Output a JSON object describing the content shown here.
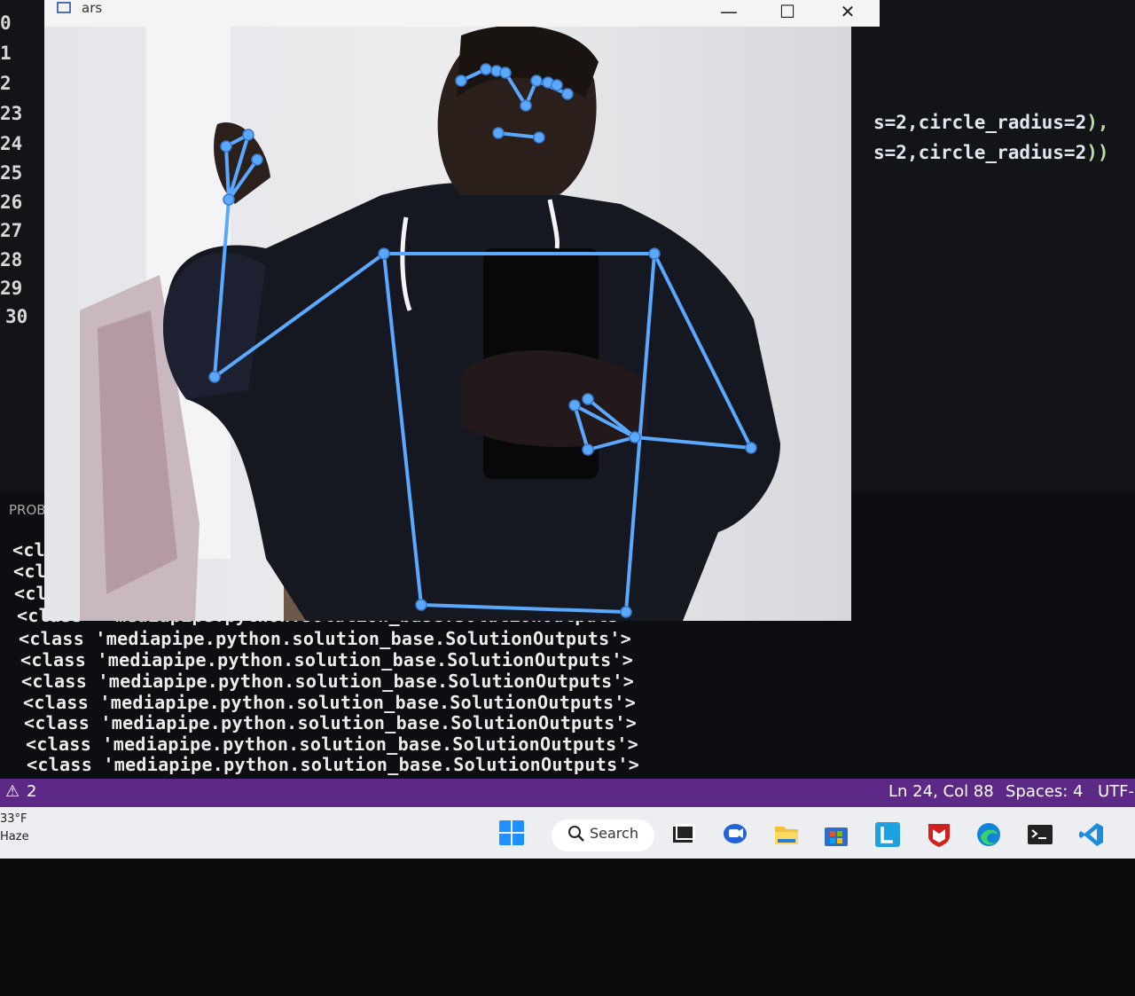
{
  "editor": {
    "line_numbers": [
      "0",
      "1",
      "2",
      "23",
      "24",
      "25",
      "26",
      "27",
      "28",
      "29",
      "30"
    ],
    "code_line_1_prefix": "s=2,circle_radius=2",
    "code_line_1_suffix": "),",
    "code_line_2_prefix": "s=2,circle_radius=2",
    "code_line_2_suffix": "))"
  },
  "panel": {
    "title": "PROBLEM",
    "output_lines": [
      "<class",
      "<class",
      "<class",
      "<class  'mediapipe.python.solution_base.SolutionOutputs'>",
      "<class 'mediapipe.python.solution_base.SolutionOutputs'>",
      "<class 'mediapipe.python.solution_base.SolutionOutputs'>",
      "<class 'mediapipe.python.solution_base.SolutionOutputs'>",
      "<class 'mediapipe.python.solution_base.SolutionOutputs'>",
      "<class 'mediapipe.python.solution_base.SolutionOutputs'>",
      "<class 'mediapipe.python.solution_base.SolutionOutputs'>",
      "<class 'mediapipe.python.solution_base.SolutionOutputs'>"
    ]
  },
  "statusbar": {
    "warnings": "2",
    "cursor": "Ln 24, Col 88",
    "spaces": "Spaces: 4",
    "encoding": "UTF-"
  },
  "taskbar": {
    "temperature": "33°F",
    "weather": "Haze",
    "search_label": "Search",
    "icons": [
      "windows-start-icon",
      "search-icon",
      "task-view-icon",
      "teams-chat-icon",
      "file-explorer-icon",
      "microsoft-store-icon",
      "lens-app-icon",
      "mcafee-icon",
      "edge-icon",
      "terminal-icon",
      "vscode-icon"
    ]
  },
  "camera_window": {
    "title": "ars",
    "minimize": "—",
    "maximize": "☐",
    "close": "✕",
    "skeleton_color": "#5aa9ff"
  }
}
